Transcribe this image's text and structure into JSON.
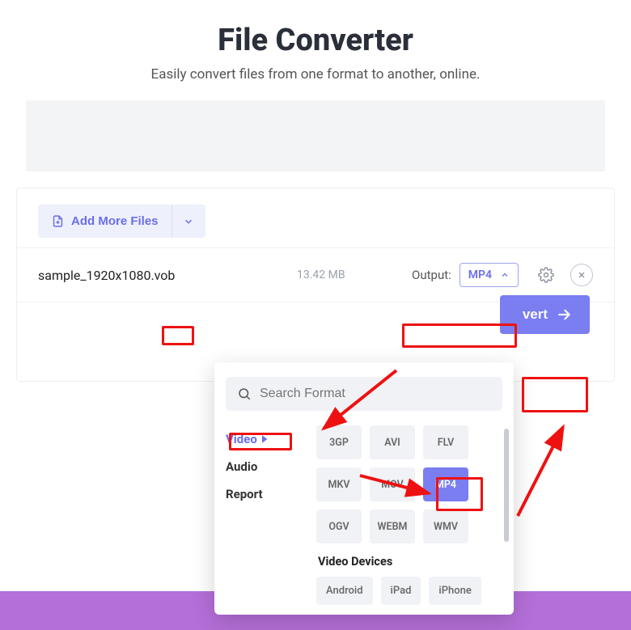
{
  "header": {
    "title": "File Converter",
    "subtitle": "Easily convert files from one format to another, online."
  },
  "toolbar": {
    "add_more_label": "Add More Files"
  },
  "file": {
    "name": "sample_1920x1080.vob",
    "size": "13.42 MB",
    "output_label": "Output:",
    "output_value": "MP4"
  },
  "convert": {
    "label": "vert"
  },
  "dropdown": {
    "search_placeholder": "Search Format",
    "categories": [
      "Video",
      "Audio",
      "Report"
    ],
    "active_category": "Video",
    "formats": [
      "3GP",
      "AVI",
      "FLV",
      "MKV",
      "MOV",
      "MP4",
      "OGV",
      "WEBM",
      "WMV"
    ],
    "selected_format": "MP4",
    "devices_title": "Video Devices",
    "devices": [
      "Android",
      "iPad",
      "iPhone"
    ]
  }
}
